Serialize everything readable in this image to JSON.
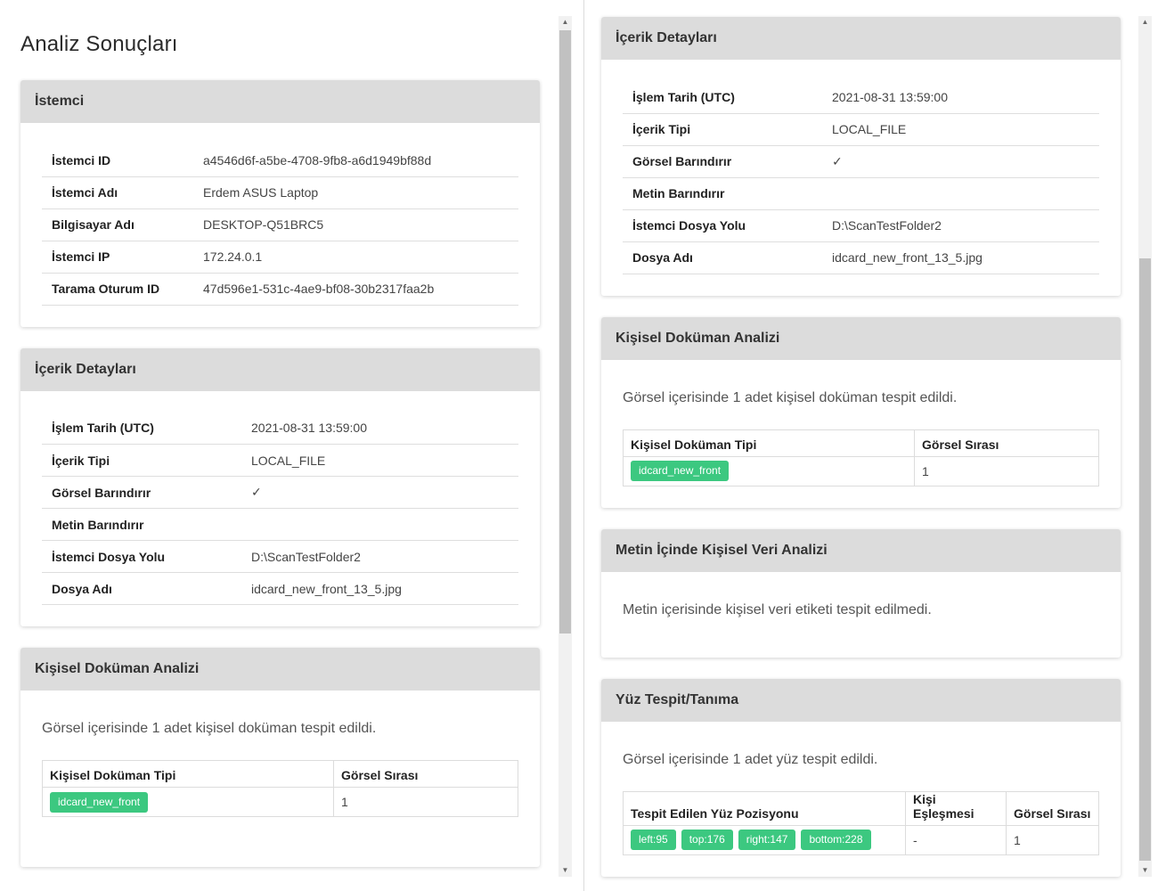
{
  "left": {
    "page_title": "Analiz Sonuçları",
    "istemci": {
      "header": "İstemci",
      "rows": [
        {
          "key": "İstemci ID",
          "value": "a4546d6f-a5be-4708-9fb8-a6d1949bf88d"
        },
        {
          "key": "İstemci Adı",
          "value": "Erdem ASUS Laptop"
        },
        {
          "key": "Bilgisayar Adı",
          "value": "DESKTOP-Q51BRC5"
        },
        {
          "key": "İstemci IP",
          "value": "172.24.0.1"
        },
        {
          "key": "Tarama Oturum ID",
          "value": "47d596e1-531c-4ae9-bf08-30b2317faa2b"
        }
      ]
    },
    "icerik": {
      "header": "İçerik Detayları",
      "rows": [
        {
          "key": "İşlem Tarih (UTC)",
          "value": "2021-08-31 13:59:00"
        },
        {
          "key": "İçerik Tipi",
          "value": "LOCAL_FILE"
        },
        {
          "key": "Görsel Barındırır",
          "value": "✓"
        },
        {
          "key": "Metin Barındırır",
          "value": ""
        },
        {
          "key": "İstemci Dosya Yolu",
          "value": "D:\\ScanTestFolder2"
        },
        {
          "key": "Dosya Adı",
          "value": "idcard_new_front_13_5.jpg"
        }
      ]
    },
    "kisisel_dokuman": {
      "header": "Kişisel Doküman Analizi",
      "message": "Görsel içerisinde 1 adet kişisel doküman tespit edildi.",
      "columns": [
        "Kişisel Doküman Tipi",
        "Görsel Sırası"
      ],
      "rows": [
        {
          "type": "idcard_new_front",
          "order": "1"
        }
      ]
    }
  },
  "right": {
    "icerik": {
      "header": "İçerik Detayları",
      "rows": [
        {
          "key": "İşlem Tarih (UTC)",
          "value": "2021-08-31 13:59:00"
        },
        {
          "key": "İçerik Tipi",
          "value": "LOCAL_FILE"
        },
        {
          "key": "Görsel Barındırır",
          "value": "✓"
        },
        {
          "key": "Metin Barındırır",
          "value": ""
        },
        {
          "key": "İstemci Dosya Yolu",
          "value": "D:\\ScanTestFolder2"
        },
        {
          "key": "Dosya Adı",
          "value": "idcard_new_front_13_5.jpg"
        }
      ]
    },
    "kisisel_dokuman": {
      "header": "Kişisel Doküman Analizi",
      "message": "Görsel içerisinde 1 adet kişisel doküman tespit edildi.",
      "columns": [
        "Kişisel Doküman Tipi",
        "Görsel Sırası"
      ],
      "rows": [
        {
          "type": "idcard_new_front",
          "order": "1"
        }
      ]
    },
    "metin_kisisel_veri": {
      "header": "Metin İçinde Kişisel Veri Analizi",
      "message": "Metin içerisinde kişisel veri etiketi tespit edilmedi."
    },
    "yuz": {
      "header": "Yüz Tespit/Tanıma",
      "message": "Görsel içerisinde 1 adet yüz tespit edildi.",
      "columns": [
        "Tespit Edilen Yüz Pozisyonu",
        "Kişi Eşleşmesi",
        "Görsel Sırası"
      ],
      "rows": [
        {
          "positions": [
            "left:95",
            "top:176",
            "right:147",
            "bottom:228"
          ],
          "match": "-",
          "order": "1"
        }
      ]
    }
  },
  "colors": {
    "badge": "#3cc880",
    "card_header": "#dcdcdc"
  },
  "icons": {
    "scroll_up": "triangle-up",
    "scroll_down": "triangle-down"
  }
}
